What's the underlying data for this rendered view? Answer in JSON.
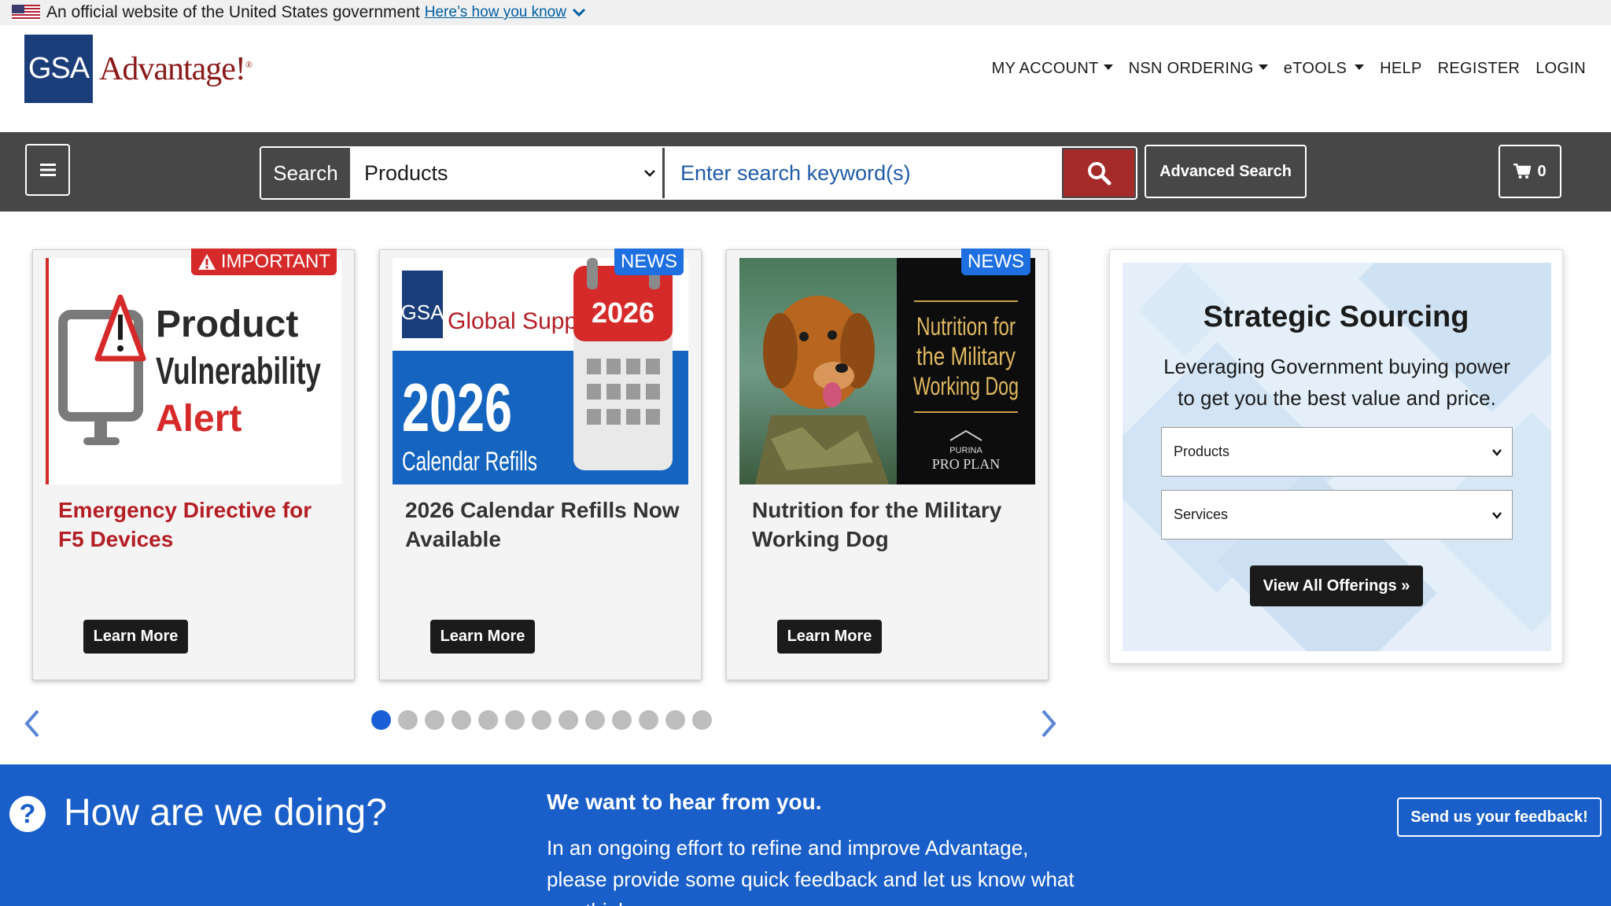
{
  "gov_banner": {
    "text": "An official website of the United States government",
    "link": "Here’s how you know"
  },
  "header": {
    "logo_box": "GSA",
    "logo_word": "Advantage!",
    "logo_mark": "®",
    "nav": {
      "my_account": "MY ACCOUNT",
      "nsn_ordering": "NSN ORDERING",
      "etools": "eTOOLS",
      "help": "HELP",
      "register": "REGISTER",
      "login": "LOGIN"
    }
  },
  "search": {
    "label": "Search",
    "category": "Products",
    "placeholder": "Enter search keyword(s)",
    "advanced": "Advanced Search",
    "cart_count": "0"
  },
  "cards": [
    {
      "badge": "IMPORTANT",
      "image_text": {
        "line1": "Product",
        "line2": "Vulnerability",
        "line3": "Alert"
      },
      "title": "Emergency Directive for F5 Devices",
      "button": "Learn More"
    },
    {
      "badge": "NEWS",
      "image_text": {
        "brand": "Global Supply",
        "logo": "GSA",
        "year": "2026",
        "sub": "Calendar Refills",
        "cal_year": "2026"
      },
      "title": "2026 Calendar Refills Now Available",
      "button": "Learn More"
    },
    {
      "badge": "NEWS",
      "image_text": {
        "line1": "Nutrition for",
        "line2": "the Military",
        "line3": "Working Dog",
        "brand1": "PURINA",
        "brand2": "PRO PLAN"
      },
      "title": "Nutrition for the Military Working Dog",
      "button": "Learn More"
    }
  ],
  "carousel": {
    "dot_count": 13,
    "active_index": 0
  },
  "strategic": {
    "title": "Strategic Sourcing",
    "text": "Leveraging Government buying power to get you the best value and price.",
    "select1": "Products",
    "select2": "Services",
    "button": "View All Offerings »"
  },
  "feedback": {
    "heading": "How are we doing?",
    "subheading": "We want to hear from you.",
    "body": "In an ongoing effort to refine and improve Advantage, please provide some quick feedback and let us know what you think.",
    "button": "Send us your feedback!"
  },
  "colors": {
    "header_bar": "#474747",
    "brand_red": "#a52a2a",
    "brand_blue": "#1b3e7a",
    "feedback_blue": "#1a5fc9",
    "badge_red": "#d62a2a",
    "badge_blue": "#1e6fe0"
  },
  "icons": [
    "us-flag-icon",
    "chevron-down-icon",
    "hamburger-icon",
    "search-icon",
    "cart-icon",
    "warning-icon",
    "chevron-left-icon",
    "chevron-right-icon",
    "question-icon"
  ]
}
